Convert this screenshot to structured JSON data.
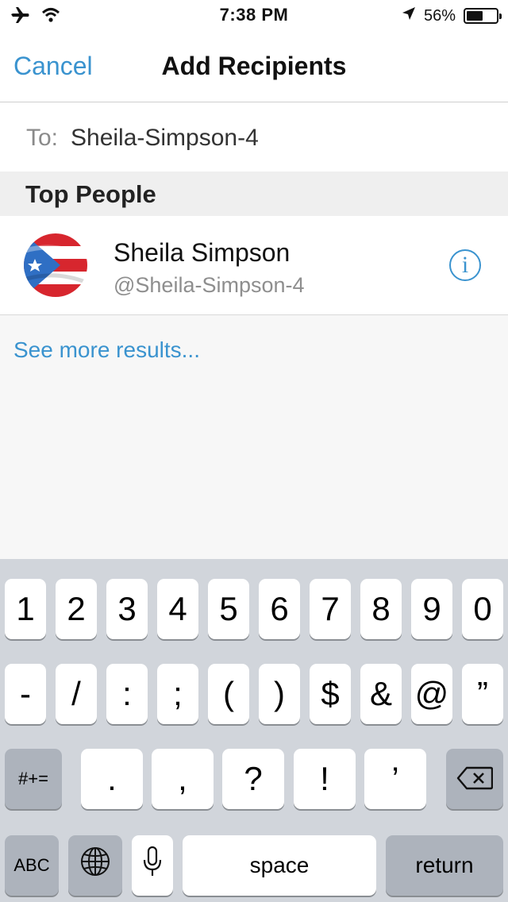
{
  "status_bar": {
    "time": "7:38 PM",
    "battery_percent": "56%",
    "battery_level": 0.56
  },
  "nav": {
    "cancel_label": "Cancel",
    "title": "Add Recipients"
  },
  "to_field": {
    "label": "To:",
    "value": "Sheila-Simpson-4"
  },
  "section": {
    "title": "Top People"
  },
  "people": [
    {
      "name": "Sheila Simpson",
      "handle": "@Sheila-Simpson-4",
      "info_icon": "i"
    }
  ],
  "see_more": "See more results...",
  "keyboard": {
    "row1": [
      "1",
      "2",
      "3",
      "4",
      "5",
      "6",
      "7",
      "8",
      "9",
      "0"
    ],
    "row2": [
      "-",
      "/",
      ":",
      ";",
      "(",
      ")",
      "$",
      "&",
      "@",
      "”"
    ],
    "row3_left": "#+=",
    "row3_keys": [
      ".",
      ",",
      "?",
      "!",
      "’"
    ],
    "abc": "ABC",
    "space": "space",
    "return": "return"
  },
  "colors": {
    "accent": "#3a93cf",
    "keyboard_bg": "#d1d5db",
    "key_dark": "#adb3bc"
  }
}
